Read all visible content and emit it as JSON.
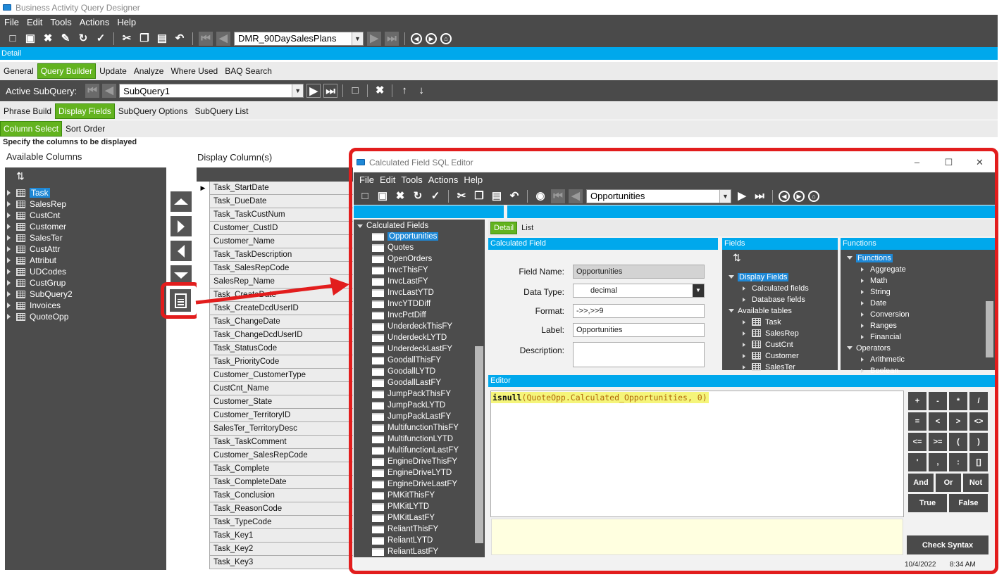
{
  "app": {
    "title": "Business Activity Query Designer"
  },
  "menu": [
    "File",
    "Edit",
    "Tools",
    "Actions",
    "Help"
  ],
  "toolbar": {
    "query_id": "DMR_90DaySalesPlans"
  },
  "detail_bar": "Detail",
  "tabs_main": [
    "General",
    "Query Builder",
    "Update",
    "Analyze",
    "Where Used",
    "BAQ Search"
  ],
  "subquery": {
    "label": "Active SubQuery:",
    "value": "SubQuery1"
  },
  "tabs_sub": [
    "Phrase Build",
    "Display Fields",
    "SubQuery Options",
    "SubQuery List"
  ],
  "tabs_col": [
    "Column Select",
    "Sort Order"
  ],
  "instruction": "Specify the columns to be displayed",
  "available": {
    "header": "Available Columns",
    "items": [
      "Task",
      "SalesRep",
      "CustCnt",
      "Customer",
      "SalesTer",
      "CustAttr",
      "Attribut",
      "UDCodes",
      "CustGrup",
      "SubQuery2",
      "Invoices",
      "QuoteOpp"
    ]
  },
  "display": {
    "header": "Display Column(s)",
    "rows": [
      "Task_StartDate",
      "Task_DueDate",
      "Task_TaskCustNum",
      "Customer_CustID",
      "Customer_Name",
      "Task_TaskDescription",
      "Task_SalesRepCode",
      "SalesRep_Name",
      "Task_CreateDate",
      "Task_CreateDcdUserID",
      "Task_ChangeDate",
      "Task_ChangeDcdUserID",
      "Task_StatusCode",
      "Task_PriorityCode",
      "Customer_CustomerType",
      "CustCnt_Name",
      "Customer_State",
      "Customer_TerritoryID",
      "SalesTer_TerritoryDesc",
      "Task_TaskComment",
      "Customer_SalesRepCode",
      "Task_Complete",
      "Task_CompleteDate",
      "Task_Conclusion",
      "Task_ReasonCode",
      "Task_TypeCode",
      "Task_Key1",
      "Task_Key2",
      "Task_Key3"
    ]
  },
  "dialog": {
    "title": "Calculated Field SQL Editor",
    "menu": [
      "File",
      "Edit",
      "Tools",
      "Actions",
      "Help"
    ],
    "current": "Opportunities",
    "tree_root": "Calculated Fields",
    "tree_items": [
      "Opportunities",
      "Quotes",
      "OpenOrders",
      "InvcThisFY",
      "InvcLastFY",
      "InvcLastYTD",
      "InvcYTDDiff",
      "InvcPctDiff",
      "UnderdeckThisFY",
      "UnderdeckLYTD",
      "UnderdeckLastFY",
      "GoodallThisFY",
      "GoodallLYTD",
      "GoodallLastFY",
      "JumpPackThisFY",
      "JumpPackLYTD",
      "JumpPackLastFY",
      "MultifunctionThisFY",
      "MultifunctionLYTD",
      "MultifunctionLastFY",
      "EngineDriveThisFY",
      "EngineDriveLYTD",
      "EngineDriveLastFY",
      "PMKitThisFY",
      "PMKitLYTD",
      "PMKitLastFY",
      "ReliantThisFY",
      "ReliantLYTD",
      "ReliantLastFY"
    ],
    "tabs": [
      "Detail",
      "List"
    ],
    "calc_header": "Calculated Field",
    "labels": {
      "field_name": "Field Name:",
      "data_type": "Data Type:",
      "format": "Format:",
      "label": "Label:",
      "description": "Description:"
    },
    "values": {
      "field_name": "Opportunities",
      "data_type": "decimal",
      "format": "->>,>>9",
      "label": "Opportunities",
      "description": ""
    },
    "fields_header": "Fields",
    "fields_tree": [
      "Display Fields",
      "Calculated fields",
      "Database fields",
      "Available tables",
      "Task",
      "SalesRep",
      "CustCnt",
      "Customer",
      "SalesTer"
    ],
    "functions_header": "Functions",
    "functions_tree": [
      "Functions",
      "Aggregate",
      "Math",
      "String",
      "Date",
      "Conversion",
      "Ranges",
      "Financial",
      "Operators",
      "Arithmetic",
      "Boolean"
    ],
    "editor_header": "Editor",
    "code": {
      "fn": "isnull",
      "args": "(QuoteOpp.Calculated_Opportunities, 0)"
    },
    "operators": [
      "+",
      "-",
      "*",
      "/",
      "=",
      "<",
      ">",
      "<>",
      "<=",
      ">=",
      "(",
      ")",
      "'",
      ",",
      ":",
      "[]",
      "And",
      "Or",
      "Not",
      "True",
      "False"
    ],
    "check_syntax": "Check Syntax",
    "status_date": "10/4/2022",
    "status_time": "8:34 AM"
  }
}
